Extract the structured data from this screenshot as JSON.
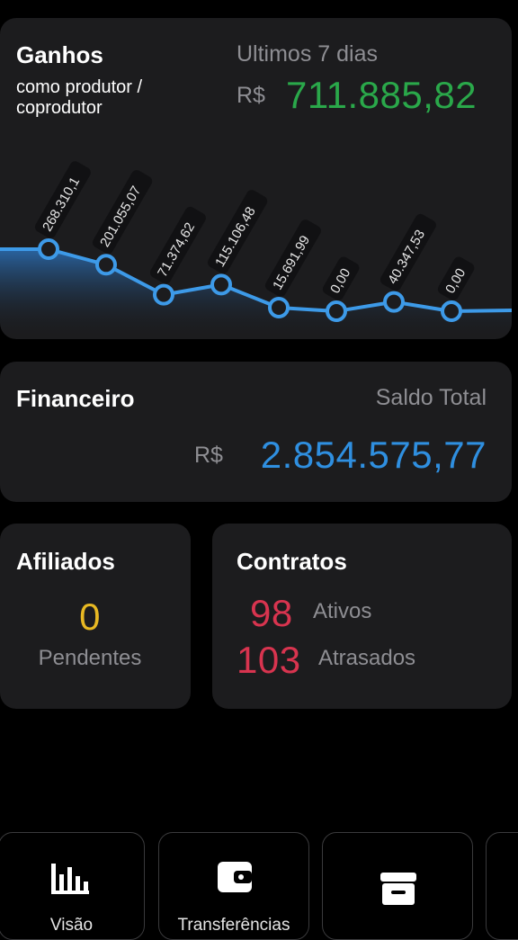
{
  "earnings": {
    "title": "Ganhos",
    "subtitle_line1": "como produtor /",
    "subtitle_line2": "coprodutor",
    "period": "Ultimos 7 dias",
    "currency": "R$",
    "amount": "711.885,82",
    "amount_color": "#2aa84a"
  },
  "chart_data": {
    "type": "area",
    "points": [
      {
        "label": "268.310,1",
        "value": 268310.1
      },
      {
        "label": "201.055,07",
        "value": 201055.07
      },
      {
        "label": "71.374,62",
        "value": 71374.62
      },
      {
        "label": "115.106,48",
        "value": 115106.48
      },
      {
        "label": "15.691,99",
        "value": 15691.99
      },
      {
        "label": "0,00",
        "value": 0
      },
      {
        "label": "40.347,53",
        "value": 40347.53
      },
      {
        "label": "0,00",
        "value": 0
      }
    ],
    "line_color": "#3d9ae8",
    "ylim": [
      0,
      268310.1
    ]
  },
  "finance": {
    "title": "Financeiro",
    "caption": "Saldo Total",
    "currency": "R$",
    "amount": "2.854.575,77",
    "amount_color": "#2f8fe0"
  },
  "affiliates": {
    "title": "Afiliados",
    "count": "0",
    "label": "Pendentes",
    "count_color": "#e8b923"
  },
  "contracts": {
    "title": "Contratos",
    "active_count": "98",
    "active_label": "Ativos",
    "late_count": "103",
    "late_label": "Atrasados",
    "count_color": "#d8344f"
  },
  "nav": {
    "items": [
      {
        "label": "Visão",
        "icon": "bar-chart-icon"
      },
      {
        "label": "Transferências",
        "icon": "wallet-icon"
      },
      {
        "label": "",
        "icon": "archive-icon"
      }
    ]
  }
}
